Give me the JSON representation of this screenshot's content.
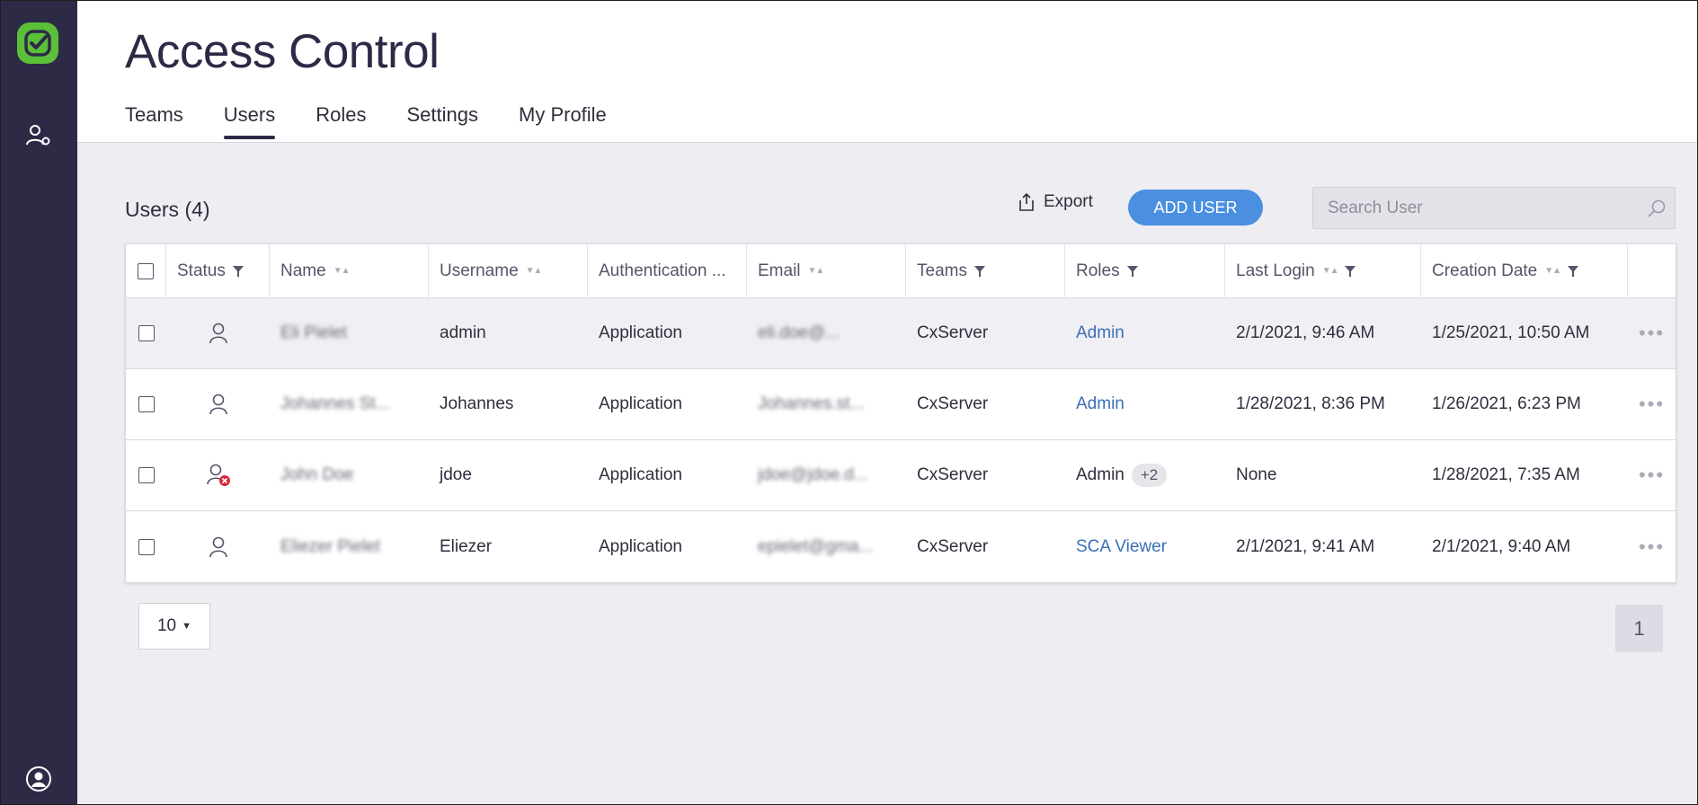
{
  "header": {
    "title": "Access Control",
    "tabs": [
      {
        "label": "Teams",
        "active": false
      },
      {
        "label": "Users",
        "active": true
      },
      {
        "label": "Roles",
        "active": false
      },
      {
        "label": "Settings",
        "active": false
      },
      {
        "label": "My Profile",
        "active": false
      }
    ]
  },
  "toolbar": {
    "users_count": "Users (4)",
    "export_label": "Export",
    "add_user_label": "ADD USER",
    "search_placeholder": "Search User"
  },
  "table": {
    "columns": [
      "Status",
      "Name",
      "Username",
      "Authentication ...",
      "Email",
      "Teams",
      "Roles",
      "Last Login",
      "Creation Date"
    ],
    "rows": [
      {
        "status": "active",
        "name": "Eli Pielet",
        "username": "admin",
        "auth": "Application",
        "email": "eli.doe@...",
        "teams": "CxServer",
        "roles": "Admin",
        "roles_extra": "",
        "last_login": "2/1/2021, 9:46 AM",
        "creation": "1/25/2021, 10:50 AM"
      },
      {
        "status": "active",
        "name": "Johannes St...",
        "username": "Johannes",
        "auth": "Application",
        "email": "Johannes.st...",
        "teams": "CxServer",
        "roles": "Admin",
        "roles_extra": "",
        "last_login": "1/28/2021, 8:36 PM",
        "creation": "1/26/2021, 6:23 PM"
      },
      {
        "status": "disabled",
        "name": "John Doe",
        "username": "jdoe",
        "auth": "Application",
        "email": "jdoe@jdoe.d...",
        "teams": "CxServer",
        "roles": "Admin",
        "roles_extra": "+2",
        "last_login": "None",
        "creation": "1/28/2021, 7:35 AM"
      },
      {
        "status": "active",
        "name": "Eliezer Pielet",
        "username": "Eliezer",
        "auth": "Application",
        "email": "epielet@gma...",
        "teams": "CxServer",
        "roles": "SCA Viewer",
        "roles_extra": "",
        "last_login": "2/1/2021, 9:41 AM",
        "creation": "2/1/2021, 9:40 AM"
      }
    ]
  },
  "pagination": {
    "page_size": "10",
    "current_page": "1"
  },
  "colors": {
    "sidebar": "#2d2a46",
    "accent": "#4a8fe0",
    "link": "#3a6fb8",
    "logo": "#5bbf3a",
    "error": "#d9263c"
  }
}
